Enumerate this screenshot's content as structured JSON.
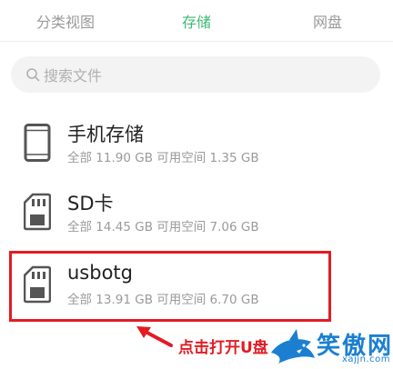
{
  "tabs": [
    {
      "label": "分类视图",
      "active": false
    },
    {
      "label": "存储",
      "active": true
    },
    {
      "label": "网盘",
      "active": false
    }
  ],
  "search": {
    "placeholder": "搜索文件",
    "icon": "search-icon"
  },
  "storage_items": [
    {
      "name": "手机存储",
      "detail": "全部 11.90 GB 可用空间 1.35 GB",
      "icon": "phone-icon"
    },
    {
      "name": "SD卡",
      "detail": "全部 14.45 GB 可用空间 7.06 GB",
      "icon": "sd-card-icon"
    },
    {
      "name": "usbotg",
      "detail": "全部 13.91 GB 可用空间 6.70 GB",
      "icon": "usb-storage-icon"
    }
  ],
  "annotation": {
    "text": "点击打开U盘",
    "color": "#e31b23"
  },
  "watermark": {
    "text": "笑傲网",
    "url": "xajjn.com",
    "color": "#1b7fd1"
  },
  "colors": {
    "accent": "#3dba76",
    "highlight": "#e31b23"
  }
}
